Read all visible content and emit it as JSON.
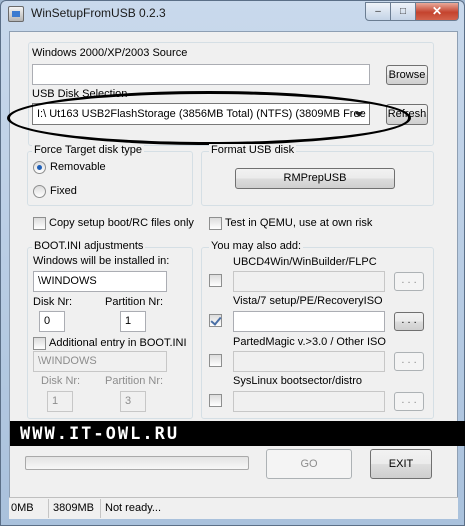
{
  "window": {
    "title": "WinSetupFromUSB 0.2.3",
    "min_glyph": "–",
    "max_glyph": "□",
    "close_glyph": "✕"
  },
  "source": {
    "label": "Windows 2000/XP/2003 Source",
    "value": "",
    "browse_label": "Browse"
  },
  "usb": {
    "label": "USB Disk Selection",
    "selected": "I:\\ Ut163 USB2FlashStorage (3856MB Total) (NTFS) (3809MB Free",
    "refresh_label": "Refresh"
  },
  "force": {
    "label": "Force Target disk type",
    "removable": "Removable",
    "fixed": "Fixed",
    "selected": "removable"
  },
  "format": {
    "label": "Format USB disk",
    "rmprep_label": "RMPrepUSB"
  },
  "options": {
    "copy_boot": "Copy setup boot/RC files only",
    "test_qemu": "Test in QEMU, use at own risk"
  },
  "bootini": {
    "label": "BOOT.INI adjustments",
    "installed_label": "Windows will be installed in:",
    "installed_value": "\\WINDOWS",
    "disk_label": "Disk Nr:",
    "disk_value": "0",
    "partition_label": "Partition Nr:",
    "partition_value": "1",
    "additional_label": "Additional entry in BOOT.INI",
    "additional_value": "\\WINDOWS",
    "disk2_label": "Disk Nr:",
    "disk2_value": "1",
    "partition2_label": "Partition Nr:",
    "partition2_value": "3"
  },
  "addons": {
    "label": "You may also add:",
    "items": [
      {
        "label": "UBCD4Win/WinBuilder/FLPC",
        "checked": false,
        "enabled": false,
        "value": "",
        "button": ". . ."
      },
      {
        "label": "Vista/7 setup/PE/RecoveryISO",
        "checked": true,
        "enabled": true,
        "value": "",
        "button": ". . ."
      },
      {
        "label": "PartedMagic v.>3.0 / Other ISO",
        "checked": false,
        "enabled": false,
        "value": "",
        "button": ". . ."
      },
      {
        "label": "SysLinux bootsector/distro",
        "checked": false,
        "enabled": false,
        "value": "",
        "button": ". . ."
      }
    ]
  },
  "banner": {
    "text": "WWW.IT-OWL.RU"
  },
  "actions": {
    "go_label": "GO",
    "exit_label": "EXIT",
    "progress": 0
  },
  "status": {
    "total": "0MB",
    "free": "3809MB",
    "message": "Not ready..."
  }
}
